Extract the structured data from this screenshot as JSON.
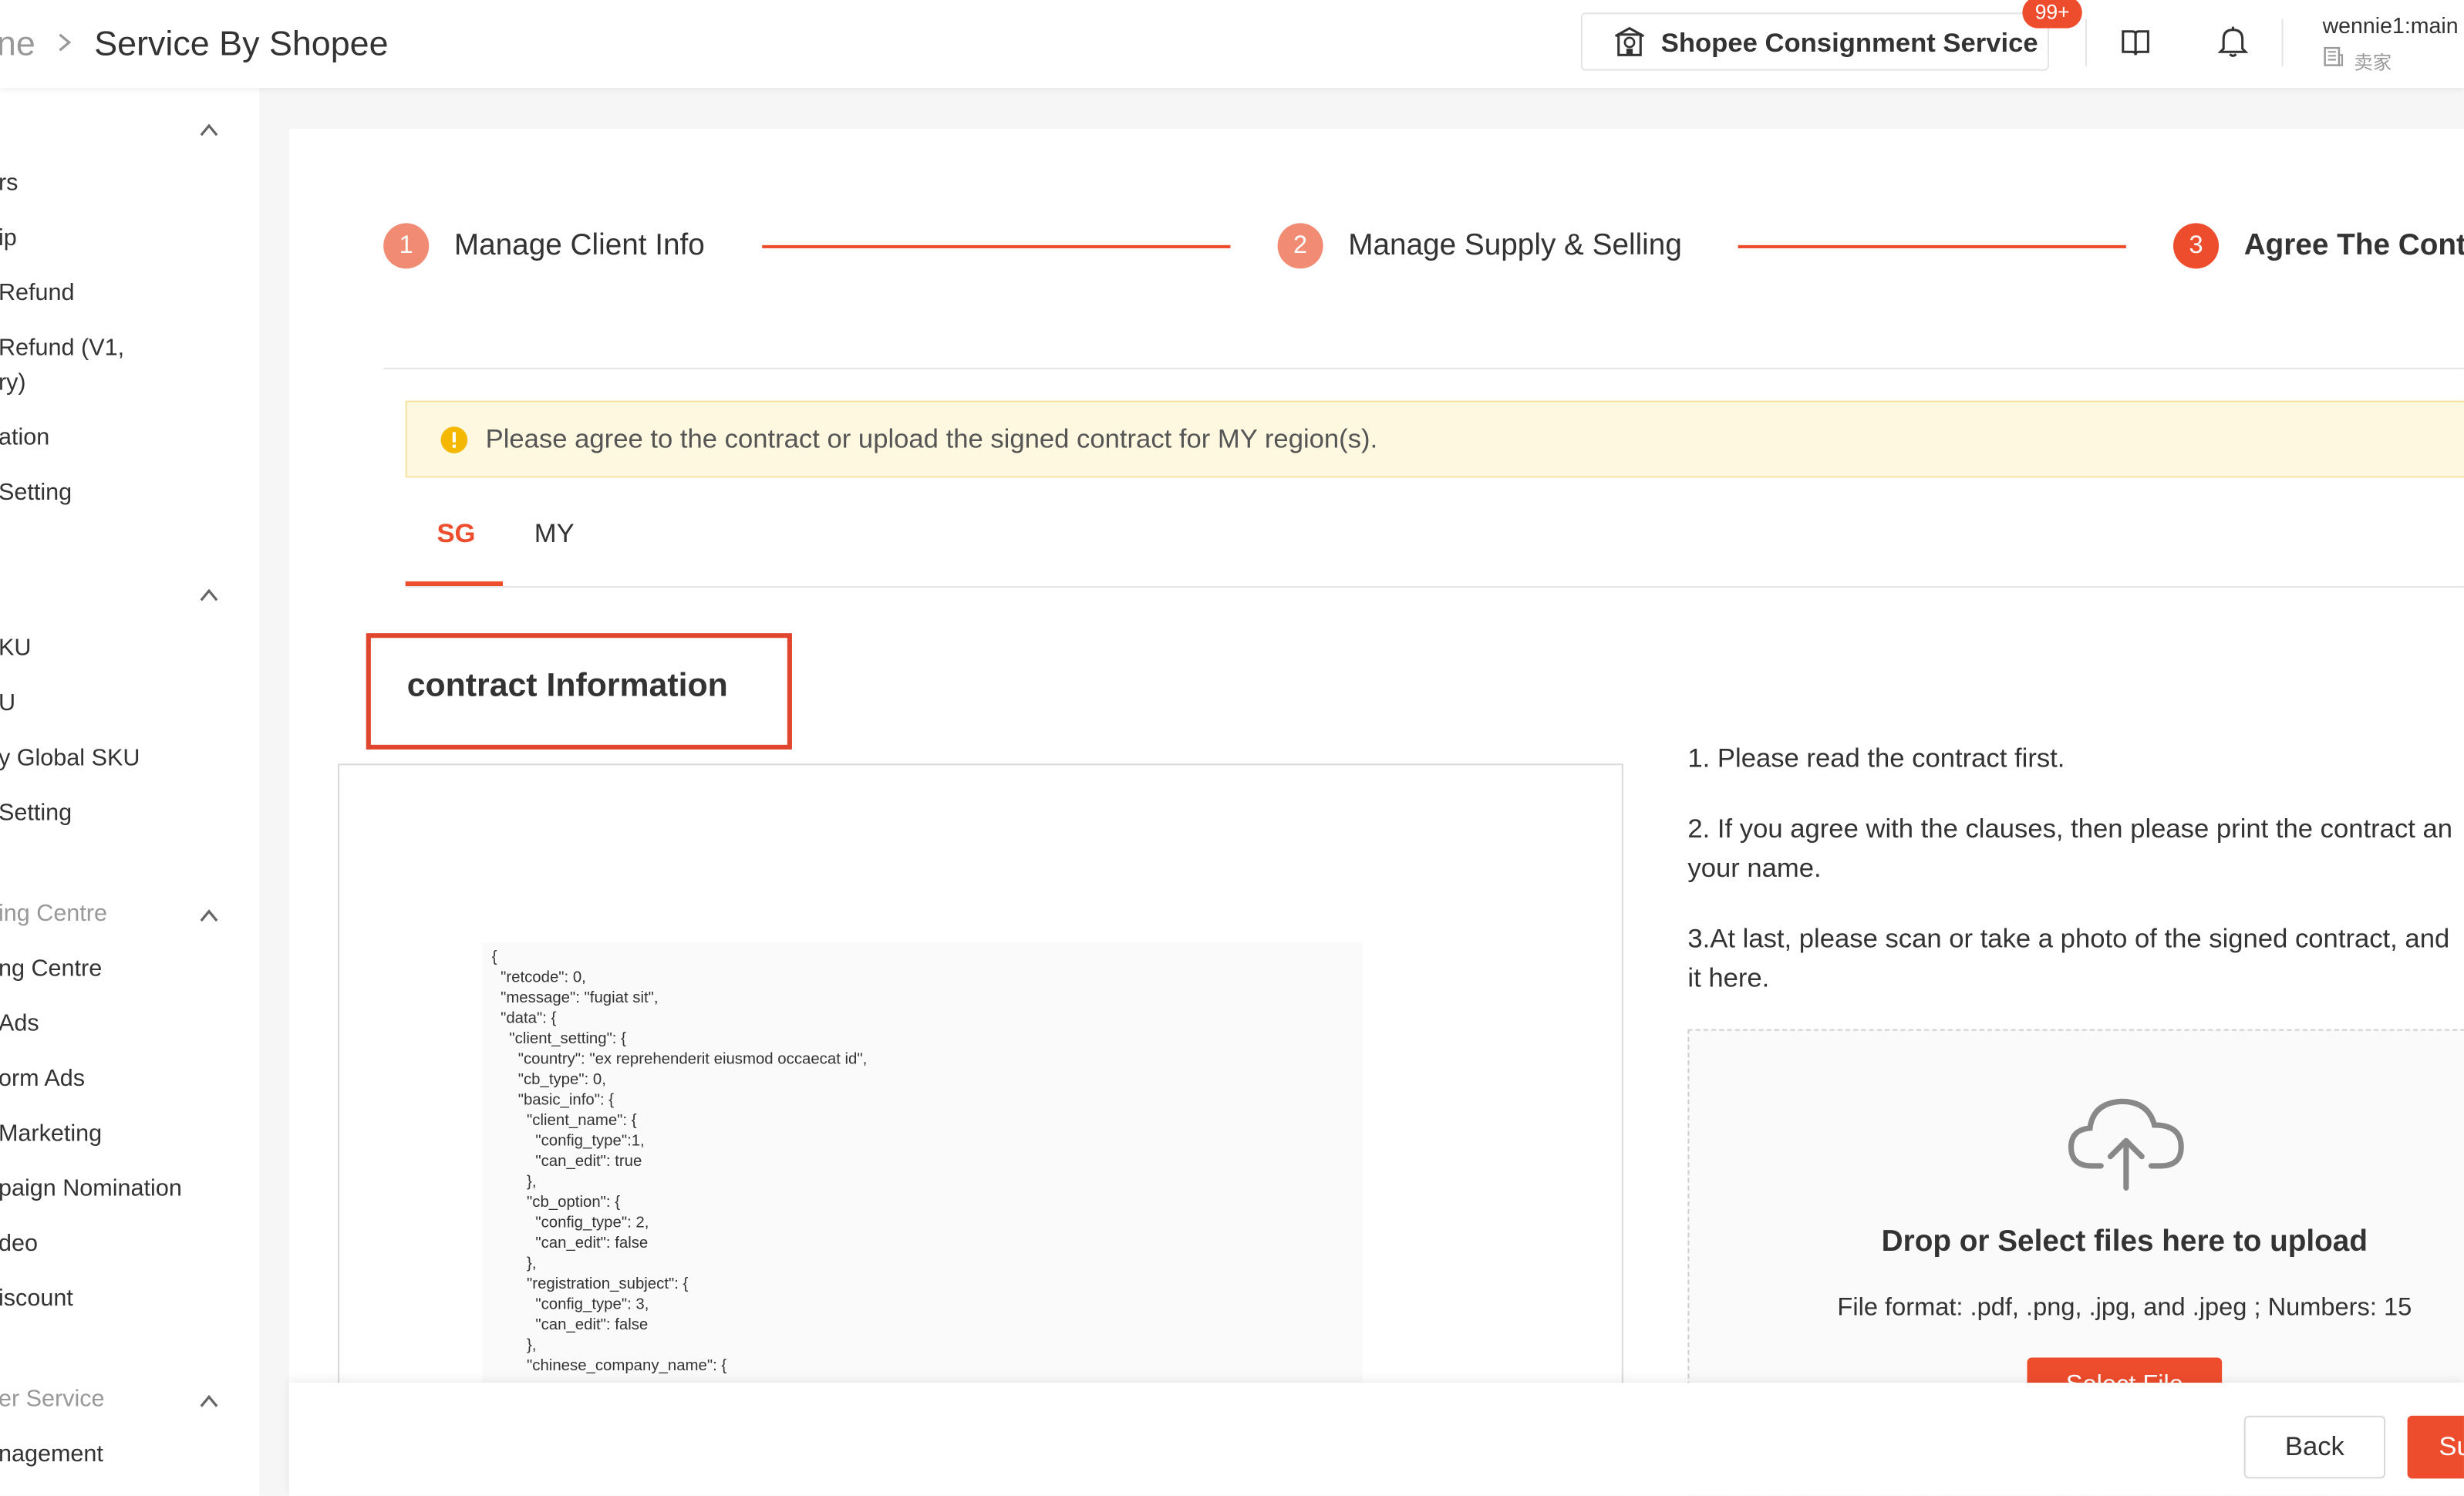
{
  "header": {
    "breadcrumb_prev": "ne",
    "title": "Service By Shopee",
    "service_button_label": "Shopee Consignment Service",
    "notification_badge": "99+",
    "user_name": "wennie1:main",
    "user_role": "卖家"
  },
  "sidebar": {
    "groups": [
      {
        "label": "",
        "items": [
          "rs",
          "ip",
          "Refund",
          "Refund (V1,",
          "ry)",
          "ation",
          "Setting"
        ]
      },
      {
        "label": "",
        "items": [
          "KU",
          "U",
          "y Global SKU",
          "Setting"
        ]
      },
      {
        "label": "ing Centre",
        "items": [
          "ng Centre",
          "Ads",
          "orm Ads",
          "Marketing",
          "paign Nomination",
          "deo",
          "iscount"
        ]
      },
      {
        "label": "er Service",
        "items": [
          "nagement"
        ]
      }
    ]
  },
  "steps": [
    {
      "number": "1",
      "label": "Manage Client Info",
      "state": "done"
    },
    {
      "number": "2",
      "label": "Manage Supply & Selling",
      "state": "done"
    },
    {
      "number": "3",
      "label": "Agree The Contr",
      "state": "active"
    }
  ],
  "notice": {
    "text": "Please agree to the contract or upload the signed contract for MY region(s)."
  },
  "tabs": [
    {
      "label": "SG",
      "active": true
    },
    {
      "label": "MY",
      "active": false
    }
  ],
  "section_title": "contract Information",
  "contract_preview_lines": [
    "{",
    "  \"retcode\": 0,",
    "  \"message\": \"fugiat sit\",",
    "  \"data\": {",
    "    \"client_setting\": {",
    "      \"country\": \"ex reprehenderit eiusmod occaecat id\",",
    "      \"cb_type\": 0,",
    "      \"basic_info\": {",
    "        \"client_name\": {",
    "          \"config_type\":1,",
    "          \"can_edit\": true",
    "        },",
    "        \"cb_option\": {",
    "          \"config_type\": 2,",
    "          \"can_edit\": false",
    "        },",
    "        \"registration_subject\": {",
    "          \"config_type\": 3,",
    "          \"can_edit\": false",
    "        },",
    "        \"chinese_company_name\": {"
  ],
  "instructions": {
    "step1": "1. Please read the contract first.",
    "step2_line1": "2. If you agree with the clauses, then please print the contract an",
    "step2_line2": "your name.",
    "step3_line1": "3.At last, please scan or take a photo of the signed contract, and",
    "step3_line2": "it here."
  },
  "upload": {
    "title": "Drop or Select files here to upload",
    "format": "File format: .pdf, .png, .jpg, and .jpeg ; Numbers: 15",
    "button": "Select File"
  },
  "footer": {
    "back_label": "Back",
    "submit_label": "Su"
  },
  "colors": {
    "accent": "#ee4d2d",
    "step_done": "#f28b73",
    "notice_bg": "#fff8e1",
    "notice_icon": "#f5b800"
  }
}
